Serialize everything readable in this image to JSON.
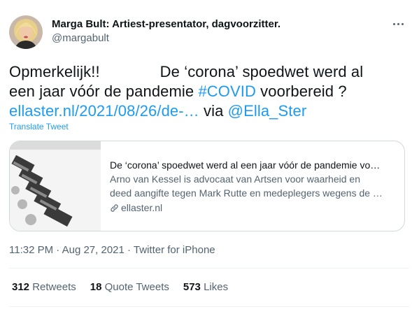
{
  "author": {
    "name": "Marga Bult: Artiest-presentator, dagvoorzitter.",
    "handle": "@margabult"
  },
  "tweet": {
    "line1_a": "Opmerkelijk!!",
    "line1_b": "De ‘corona’ spoedwet werd al",
    "line2_a": "een jaar vóór de pandemie ",
    "line2_hashtag": "#COVID",
    "line2_b": " voorbereid ?",
    "line3_link": "ellaster.nl/2021/08/26/de-…",
    "line3_via": " via ",
    "line3_mention": "@Ella_Ster",
    "translate_label": "Translate Tweet"
  },
  "card": {
    "title": "De ‘corona’ spoedwet werd al een jaar vóór de pandemie vo…",
    "desc_line1": "Arno van Kessel is advocaat van Artsen voor waarheid en",
    "desc_line2": "deed aangifte tegen Mark Rutte en medeplegers wegens de …",
    "domain": "ellaster.nl",
    "thumb_icon": "printing-press-photo"
  },
  "meta": {
    "time": "11:32 PM",
    "sep": " · ",
    "date": "Aug 27, 2021",
    "source": "Twitter for iPhone"
  },
  "stats": {
    "retweets_count": "312",
    "retweets_label": "Retweets",
    "quotes_count": "18",
    "quotes_label": "Quote Tweets",
    "likes_count": "573",
    "likes_label": "Likes"
  },
  "colors": {
    "link": "#1d9bf0",
    "secondary_text": "#536471",
    "primary_text": "#0f1419",
    "border": "#cfd9de"
  }
}
